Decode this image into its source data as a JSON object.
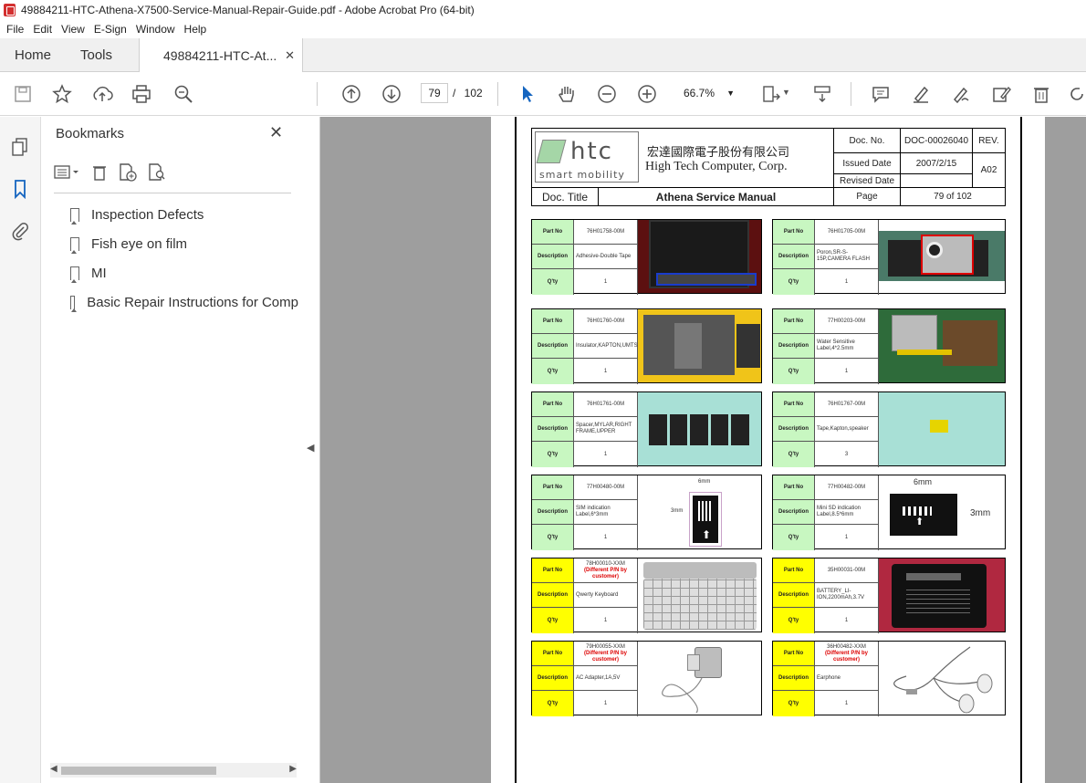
{
  "window": {
    "title": "49884211-HTC-Athena-X7500-Service-Manual-Repair-Guide.pdf - Adobe Acrobat Pro (64-bit)"
  },
  "menu": [
    "File",
    "Edit",
    "View",
    "E-Sign",
    "Window",
    "Help"
  ],
  "tabs": {
    "home": "Home",
    "tools": "Tools",
    "doc": "49884211-HTC-At..."
  },
  "toolbar": {
    "page_current": "79",
    "page_total": "102",
    "zoom": "66.7%"
  },
  "bookmarks": {
    "title": "Bookmarks",
    "items": [
      "Inspection Defects",
      "Fish eye on film",
      "MI",
      "Basic Repair Instructions for Comp"
    ]
  },
  "doc": {
    "header": {
      "logo_text": "htc",
      "logo_sub": "smart mobility",
      "cn_name": "宏達國際電子股份有限公司",
      "en_name": "High Tech Computer, Corp.",
      "doc_no_label": "Doc. No.",
      "doc_no": "DOC-00026040",
      "rev_label": "REV.",
      "rev": "A02",
      "issued_label": "Issued Date",
      "issued": "2007/2/15",
      "revised_label": "Revised Date",
      "doc_title_label": "Doc. Title",
      "doc_title": "Athena Service Manual",
      "page_label": "Page",
      "page_val": "79  of  102"
    },
    "labels": {
      "part": "Part No",
      "desc": "Description",
      "qty": "Q'ty"
    },
    "parts": [
      {
        "part": "76H01758-00M",
        "desc": "Adhesive-Double Tape",
        "qty": "1",
        "color": "#c8f7c1"
      },
      {
        "part": "76H01705-00M",
        "desc": "Poron,SR-S-15P,CAMERA FLASH",
        "qty": "1",
        "color": "#c8f7c1"
      },
      {
        "part": "76H01760-00M",
        "desc": "Insulator,KAPTON,UMTS,board",
        "qty": "1",
        "color": "#c8f7c1"
      },
      {
        "part": "77H00203-00M",
        "desc": "Water Sensitive Label,4*2.5mm",
        "qty": "1",
        "color": "#c8f7c1"
      },
      {
        "part": "76H01761-00M",
        "desc": "Spacer,MYLAR,RIGHT FRAME,UPPER",
        "qty": "1",
        "color": "#c8f7c1"
      },
      {
        "part": "76H01767-00M",
        "desc": "Tape,Kapton,speaker",
        "qty": "3",
        "color": "#c8f7c1"
      },
      {
        "part": "77H00480-00M",
        "desc": "SIM indication Label,6*3mm",
        "qty": "1",
        "color": "#c8f7c1"
      },
      {
        "part": "77H00482-00M",
        "desc": "Mini SD indication Label,8.5*6mm",
        "qty": "1",
        "color": "#c8f7c1"
      },
      {
        "part": "78H00010-XXM",
        "part_note": "(Different P/N by customer)",
        "desc": "Qwerty Keyboard",
        "qty": "1",
        "color": "#ffff00"
      },
      {
        "part": "35H00031-00M",
        "desc": "BATTERY_LI-ION,2200mAh,3.7V",
        "qty": "1",
        "color": "#ffff00"
      },
      {
        "part": "79H00055-XXM",
        "part_note": "(Different P/N by customer)",
        "desc": "AC Adapter,1A,5V",
        "qty": "1",
        "color": "#ffff00"
      },
      {
        "part": "36H00482-XXM",
        "part_note": "(Different P/N by customer)",
        "desc": "Earphone",
        "qty": "1",
        "color": "#ffff00"
      }
    ],
    "img_labels": {
      "sim_w": "6mm",
      "sim_h": "3mm",
      "sd_w": "6mm",
      "sd_h": "3mm"
    }
  }
}
